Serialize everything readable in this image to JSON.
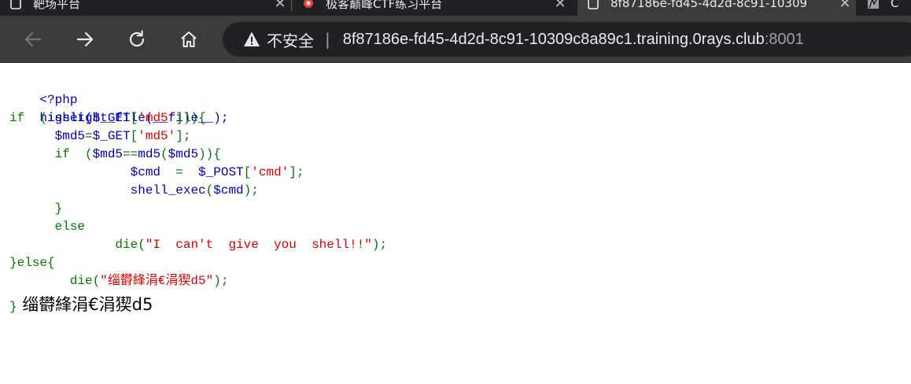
{
  "tabs": [
    {
      "title": "靶场平台",
      "active": false
    },
    {
      "title": "极客巅峰CTF练习平台",
      "active": false
    },
    {
      "title": "8f87186e-fd45-4d2d-8c91-10309",
      "active": true
    },
    {
      "title": "C",
      "active": false
    }
  ],
  "tab_close_glyph": "✕",
  "address_bar": {
    "security_label": "不安全",
    "divider": "|",
    "host": "8f87186e-fd45-4d2d-8c91-10309c8a89c1.training.0rays.club",
    "port": ":8001"
  },
  "icons": [
    "back-arrow-icon",
    "forward-arrow-icon",
    "reload-icon",
    "home-icon",
    "warning-icon",
    "page-icon"
  ],
  "colors": {
    "html": "#0000BB",
    "keyword": "#007700",
    "string": "#DD0000",
    "chrome_bg": "#3c3c3c",
    "tabstrip_bg": "#202124"
  },
  "code": {
    "l1": "<?php",
    "l2": "highlight_file(__file__);",
    "l3a": "if  (",
    "l3b": "isset(",
    "l3c": "$_GET",
    "l3d": "[",
    "l3e": "'md5'",
    "l3f": "])){",
    "l4a": "      $md5",
    "l4b": "=",
    "l4c": "$_GET",
    "l4d": "[",
    "l4e": "'md5'",
    "l4f": "];",
    "l5a": "      if  (",
    "l5b": "$md5",
    "l5c": "==",
    "l5d": "md5",
    "l5e": "(",
    "l5f": "$md5",
    "l5g": ")){",
    "l6a": "                $cmd  ",
    "l6b": "=  ",
    "l6c": "$_POST",
    "l6d": "[",
    "l6e": "'cmd'",
    "l6f": "];",
    "l7a": "                shell_exec",
    "l7b": "(",
    "l7c": "$cmd",
    "l7d": ");",
    "l8": "      }",
    "l9": "      else",
    "l10a": "              die(",
    "l10b": "\"I  can't  give  you  shell!!\"",
    "l10c": ");",
    "l11": "}else{",
    "l12a": "        die(",
    "l12b": "\"缁欎綘涓€涓猰d5\"",
    "l12c": ");"
  },
  "output": {
    "brace": "}",
    "text": "缁欎綘涓€涓猰d5"
  }
}
